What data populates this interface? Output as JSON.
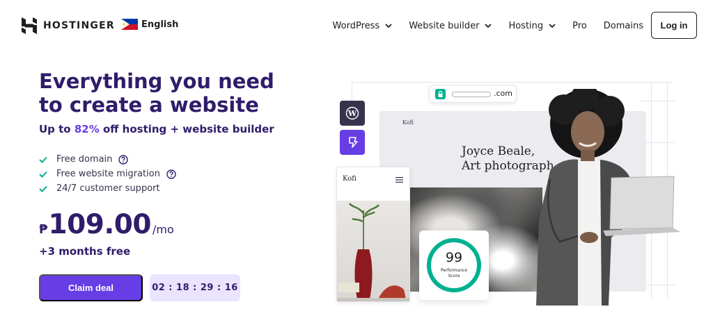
{
  "brand": {
    "name": "HOSTINGER"
  },
  "language": {
    "label": "English"
  },
  "nav": {
    "items": [
      {
        "label": "WordPress",
        "has_dropdown": true
      },
      {
        "label": "Website builder",
        "has_dropdown": true
      },
      {
        "label": "Hosting",
        "has_dropdown": true
      },
      {
        "label": "Pro",
        "has_dropdown": false
      },
      {
        "label": "Domains",
        "has_dropdown": false
      }
    ],
    "login_label": "Log in"
  },
  "hero": {
    "headline": "Everything you need to create a website",
    "subline_prefix": "Up to ",
    "subline_percent": "82%",
    "subline_suffix": " off hosting + website builder",
    "features": [
      {
        "label": "Free domain",
        "has_help": true
      },
      {
        "label": "Free website migration",
        "has_help": true
      },
      {
        "label": "24/7 customer support",
        "has_help": false
      }
    ],
    "price": {
      "currency": "₱",
      "amount": "109.00",
      "period": "/mo"
    },
    "bonus": "+3 months free",
    "cta_label": "Claim deal",
    "countdown": "02 : 18 : 29 : 16"
  },
  "illustration": {
    "url_tld": ".com",
    "site_brand": "Kofi",
    "site_title_line1": "Joyce Beale,",
    "site_title_line2": "Art photograph",
    "mobile_brand": "Kofi",
    "performance": {
      "score": "99",
      "label_line1": "Performance",
      "label_line2": "Score",
      "fraction": 0.99
    }
  },
  "colors": {
    "primary": "#673de6",
    "heading": "#2f1c6a",
    "success": "#00b090",
    "timer_bg": "#ebe4ff"
  }
}
